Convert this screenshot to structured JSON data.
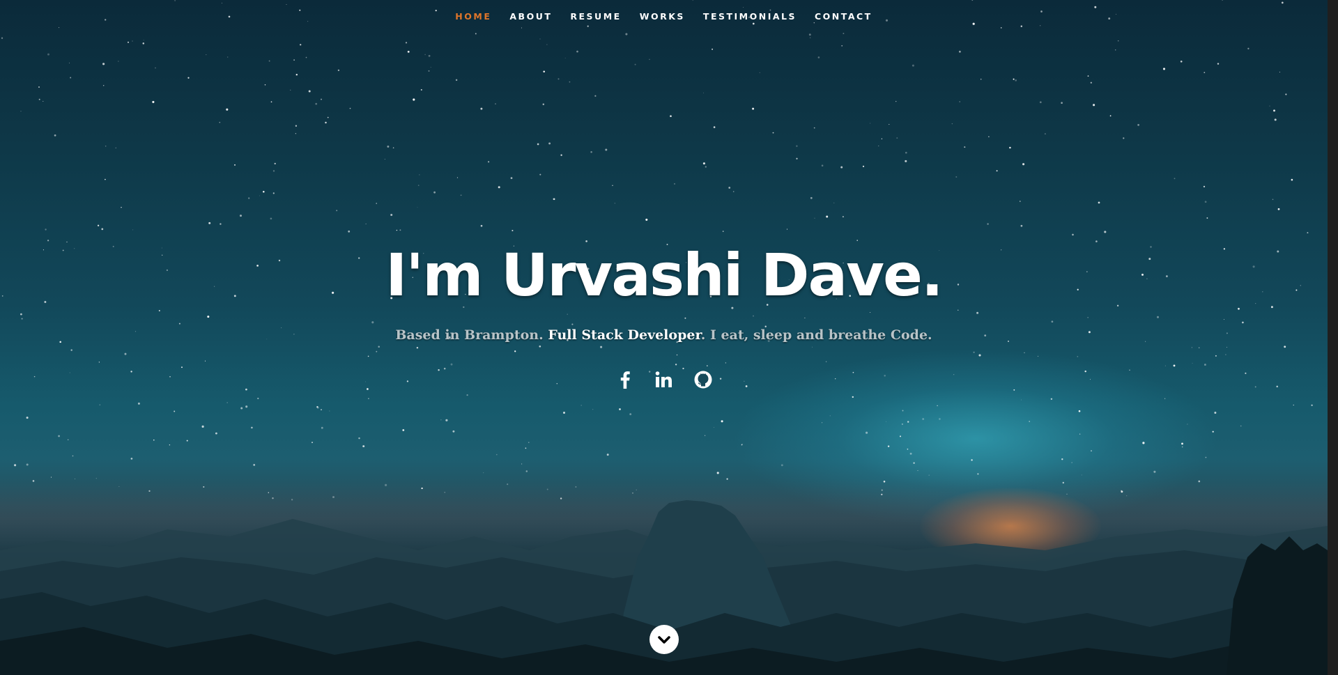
{
  "nav": {
    "items": [
      {
        "label": "HOME",
        "active": true
      },
      {
        "label": "ABOUT",
        "active": false
      },
      {
        "label": "RESUME",
        "active": false
      },
      {
        "label": "WORKS",
        "active": false
      },
      {
        "label": "TESTIMONIALS",
        "active": false
      },
      {
        "label": "CONTACT",
        "active": false
      }
    ],
    "active_color": "#e0762a"
  },
  "banner": {
    "headline": "I'm Urvashi Dave.",
    "tagline_pre": "Based in Brampton. ",
    "tagline_highlight": "Full Stack Developer",
    "tagline_post": ". I eat, sleep and breathe Code."
  },
  "social": {
    "links": [
      {
        "icon": "facebook-icon"
      },
      {
        "icon": "linkedin-icon"
      },
      {
        "icon": "github-icon"
      }
    ]
  },
  "scroll": {
    "icon": "chevron-down-icon"
  }
}
